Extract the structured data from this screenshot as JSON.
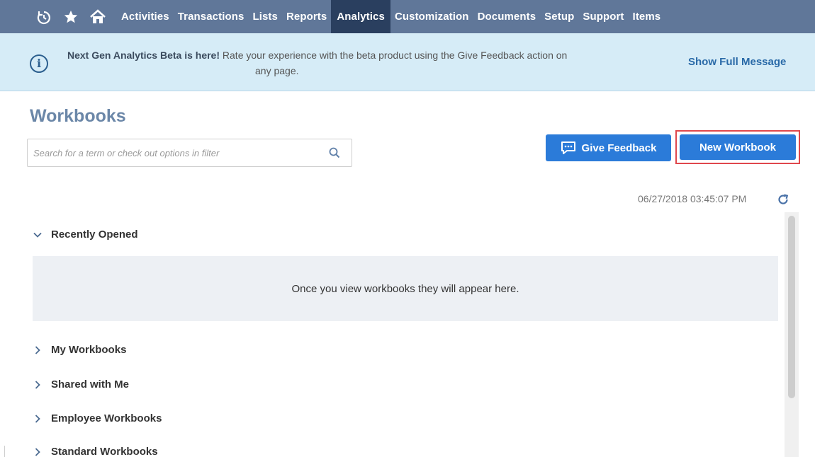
{
  "nav": {
    "icons": [
      "recent-icon",
      "star-icon",
      "home-icon"
    ],
    "items": [
      {
        "label": "Activities",
        "active": false
      },
      {
        "label": "Transactions",
        "active": false
      },
      {
        "label": "Lists",
        "active": false
      },
      {
        "label": "Reports",
        "active": false
      },
      {
        "label": "Analytics",
        "active": true
      },
      {
        "label": "Customization",
        "active": false
      },
      {
        "label": "Documents",
        "active": false
      },
      {
        "label": "Setup",
        "active": false
      },
      {
        "label": "Support",
        "active": false
      },
      {
        "label": "Items",
        "active": false
      }
    ]
  },
  "banner": {
    "icon": "info-icon",
    "title": "Next Gen Analytics Beta is here!",
    "message_line1": "Rate your experience with the beta product using the Give Feedback action on",
    "message_line2": "any page.",
    "show_full": "Show Full Message"
  },
  "page": {
    "title": "Workbooks"
  },
  "search": {
    "placeholder": "Search for a term or check out options in filter",
    "value": ""
  },
  "actions": {
    "feedback_label": "Give Feedback",
    "new_workbook_label": "New Workbook"
  },
  "timestamp": "06/27/2018 03:45:07 PM",
  "sections": {
    "recently_opened": {
      "label": "Recently Opened",
      "expanded": true,
      "empty_message": "Once you view workbooks they will appear here."
    },
    "my_workbooks": {
      "label": "My Workbooks",
      "expanded": false
    },
    "shared_with_me": {
      "label": "Shared with Me",
      "expanded": false
    },
    "employee_workbooks": {
      "label": "Employee Workbooks",
      "expanded": false
    },
    "standard_workbooks": {
      "label": "Standard Workbooks",
      "expanded": false
    }
  },
  "colors": {
    "nav_bg": "#607799",
    "nav_active": "#2a3f5f",
    "banner_bg": "#d6ecf7",
    "primary_button": "#2b7bd9",
    "highlight_border": "#e0474c",
    "title": "#6b87a8"
  }
}
